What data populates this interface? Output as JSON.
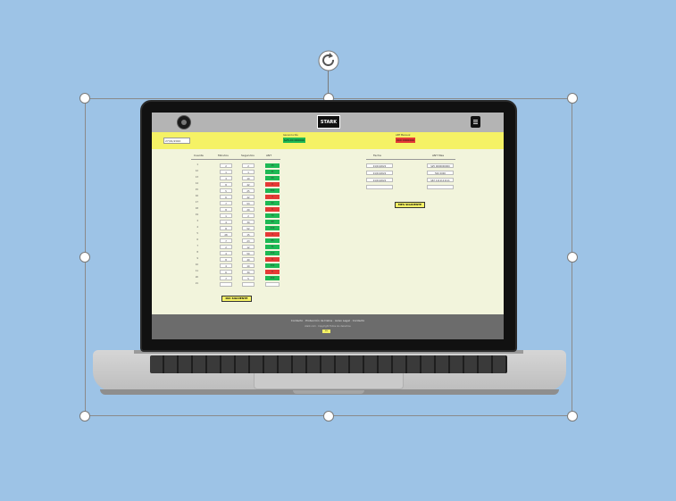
{
  "site": {
    "brand": "STARK",
    "date_value": "27/01/2022",
    "stat_left": {
      "label": "Ganancia Día",
      "value": "$25.00 000000"
    },
    "stat_right": {
      "label": "ANT Mensual",
      "value": "000 0000000"
    },
    "table": {
      "headers": [
        "Cuenta",
        "Minutos",
        "Segundos",
        "ANT"
      ],
      "rows": [
        {
          "label": "1",
          "min": "2",
          "sec": "2",
          "ant": "15",
          "status": "green"
        },
        {
          "label": "12",
          "min": "1",
          "sec": "1",
          "ant": "11",
          "status": "green"
        },
        {
          "label": "13",
          "min": "3",
          "sec": "10",
          "ant": "20",
          "status": "green"
        },
        {
          "label": "14",
          "min": "8",
          "sec": "42",
          "ant": "0",
          "status": "red"
        },
        {
          "label": "15",
          "min": "5",
          "sec": "25",
          "ant": "300",
          "status": "green"
        },
        {
          "label": "16",
          "min": "6",
          "sec": "42",
          "ant": "1",
          "status": "red"
        },
        {
          "label": "17",
          "min": "7",
          "sec": "53",
          "ant": "90",
          "status": "green"
        },
        {
          "label": "18",
          "min": "8",
          "sec": "20",
          "ant": "0",
          "status": "red"
        },
        {
          "label": "19",
          "min": "1",
          "sec": "2",
          "ant": "70",
          "status": "green"
        },
        {
          "label": "3",
          "min": "4",
          "sec": "30",
          "ant": "99",
          "status": "green"
        },
        {
          "label": "4",
          "min": "8",
          "sec": "52",
          "ant": "410",
          "status": "green"
        },
        {
          "label": "5",
          "min": "28",
          "sec": "15",
          "ant": "1",
          "status": "red"
        },
        {
          "label": "6",
          "min": "7",
          "sec": "23",
          "ant": "95",
          "status": "green"
        },
        {
          "label": "7",
          "min": "2",
          "sec": "12",
          "ant": "71",
          "status": "green"
        },
        {
          "label": "8",
          "min": "4",
          "sec": "50",
          "ant": "250",
          "status": "green"
        },
        {
          "label": "9",
          "min": "8",
          "sec": "40",
          "ant": "0",
          "status": "red"
        },
        {
          "label": "10",
          "min": "4",
          "sec": "10",
          "ant": "300",
          "status": "green"
        },
        {
          "label": "11",
          "min": "6",
          "sec": "30",
          "ant": "0",
          "status": "red"
        },
        {
          "label": "20",
          "min": "7",
          "sec": "5",
          "ant": "450",
          "status": "green"
        },
        {
          "label": "21",
          "min": "",
          "sec": "",
          "ant": "",
          "status": "empty"
        }
      ],
      "next_day_button": "DIA SIGUIENTE"
    },
    "month_table": {
      "headers": [
        "Fecha",
        "ANT Mes"
      ],
      "rows": [
        {
          "date": "01/01/2022",
          "value": "$25 0000000000"
        },
        {
          "date": "01/01/2022",
          "value": "500 0000"
        },
        {
          "date": "01/01/2022",
          "value": "$67 1111111111"
        },
        {
          "date": "",
          "value": ""
        }
      ],
      "next_month_button": "MES SIGUIENTE"
    },
    "footer": {
      "links": "Contacto · Protección de Datos · Aviso Legal · Contacto",
      "copyright": "stark.com · Copyright Todos los derechos",
      "badge": "ES"
    }
  }
}
